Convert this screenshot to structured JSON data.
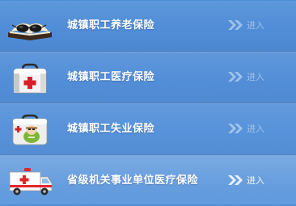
{
  "menu": {
    "items": [
      {
        "label": "城镇职工养老保险",
        "enter": "进入"
      },
      {
        "label": "城镇职工医疗保险",
        "enter": "进入"
      },
      {
        "label": "城镇职工失业保险",
        "enter": "进入"
      },
      {
        "label": "省级机关事业单位医疗保险",
        "enter": "进入"
      }
    ]
  },
  "icons": [
    "book-glasses-icon",
    "medical-kit-icon",
    "unemployment-kit-icon",
    "ambulance-icon"
  ],
  "colors": {
    "background": "#4f8cd7",
    "label_text": "#ffffff",
    "enter_dim": "#a9c4ea",
    "enter_active": "#ffffff"
  }
}
